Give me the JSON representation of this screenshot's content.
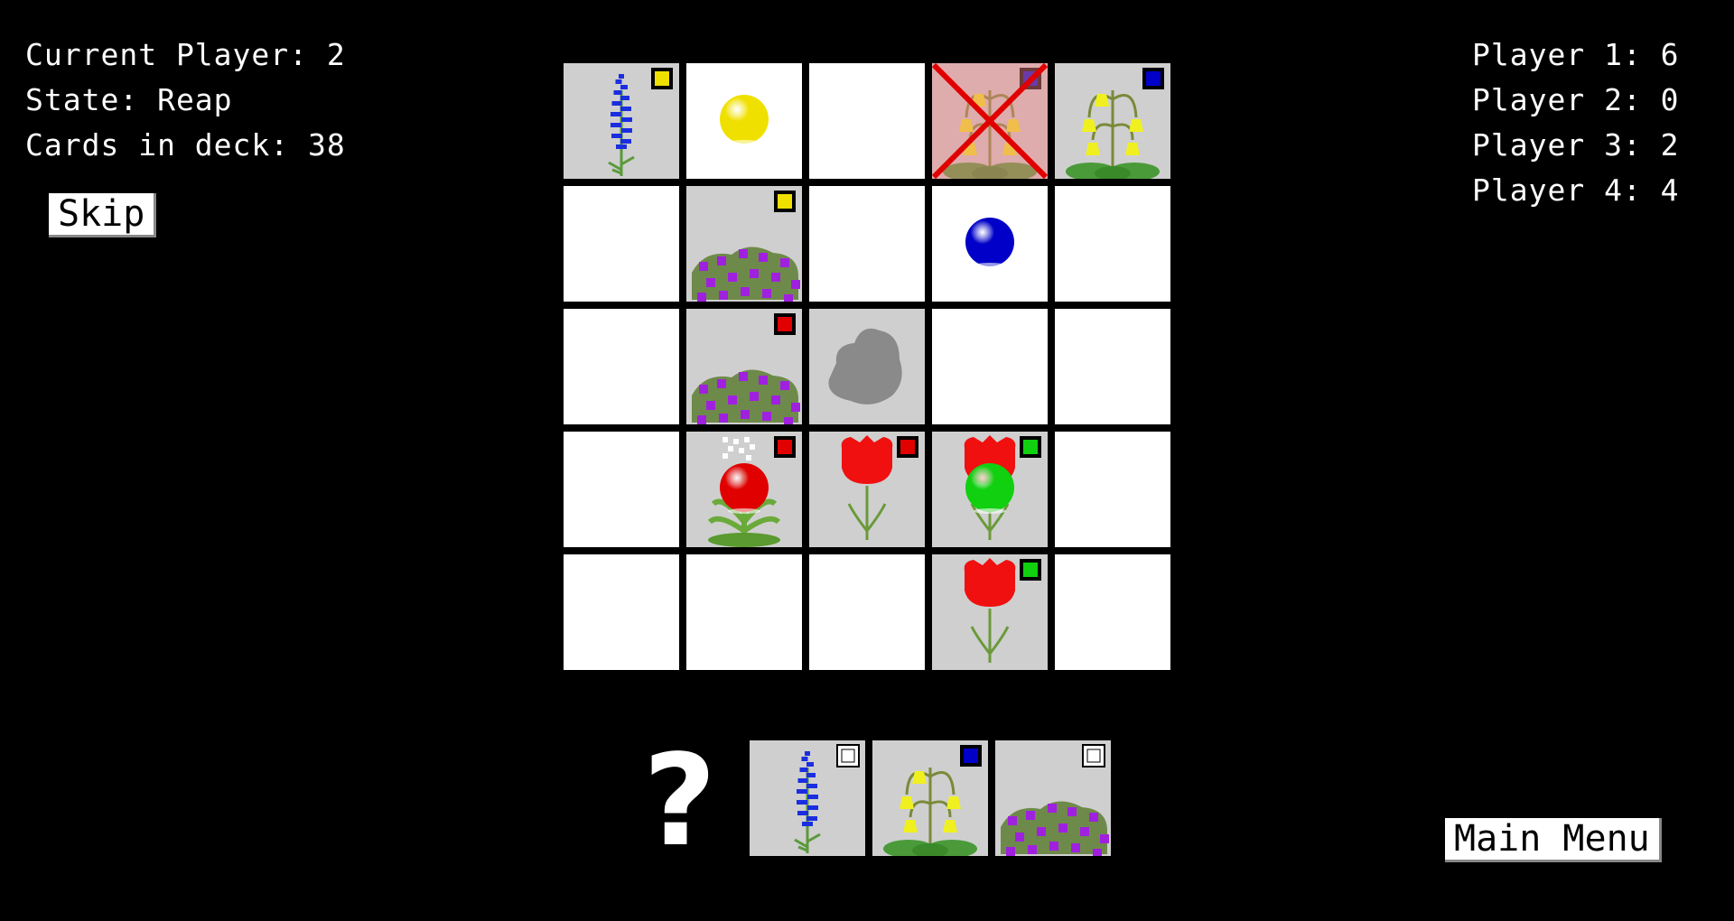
{
  "status": {
    "current_player": "Current Player: 2",
    "state": "State: Reap",
    "deck": "Cards in deck: 38"
  },
  "buttons": {
    "skip": "Skip",
    "main_menu": "Main Menu"
  },
  "scores": [
    "Player 1: 6",
    "Player 2: 0",
    "Player 3: 2",
    "Player 4: 4"
  ],
  "hand_unknown": "?",
  "colors": {
    "player_yellow": "#f0e000",
    "player_blue": "#0000c8",
    "player_red": "#e00000",
    "player_green": "#10d010",
    "card_bg": "#cfcfcf",
    "empty_cell": "#ffffff"
  },
  "board": [
    [
      {
        "card": "larkspur",
        "marker": "yellow"
      },
      {
        "card": "empty",
        "token": "yellow"
      },
      {
        "card": "empty"
      },
      {
        "card": "bluebell",
        "marker": "blue",
        "crossed": true
      },
      {
        "card": "bluebell",
        "marker": "blue"
      }
    ],
    [
      {
        "card": "empty"
      },
      {
        "card": "heather",
        "marker": "yellow"
      },
      {
        "card": "empty"
      },
      {
        "card": "empty",
        "token": "blue"
      },
      {
        "card": "empty"
      }
    ],
    [
      {
        "card": "empty"
      },
      {
        "card": "heather",
        "marker": "red"
      },
      {
        "card": "rock"
      },
      {
        "card": "empty"
      },
      {
        "card": "empty"
      }
    ],
    [
      {
        "card": "empty"
      },
      {
        "card": "hellebore",
        "marker": "red",
        "token": "red"
      },
      {
        "card": "tulip",
        "marker": "red"
      },
      {
        "card": "tulip",
        "marker": "green",
        "token": "green"
      },
      {
        "card": "empty"
      }
    ],
    [
      {
        "card": "empty"
      },
      {
        "card": "empty"
      },
      {
        "card": "empty"
      },
      {
        "card": "tulip",
        "marker": "green"
      },
      {
        "card": "empty"
      }
    ]
  ],
  "hand": [
    {
      "card": "larkspur",
      "marker": "none"
    },
    {
      "card": "bluebell",
      "marker": "blue"
    },
    {
      "card": "heather",
      "marker": "none"
    }
  ]
}
